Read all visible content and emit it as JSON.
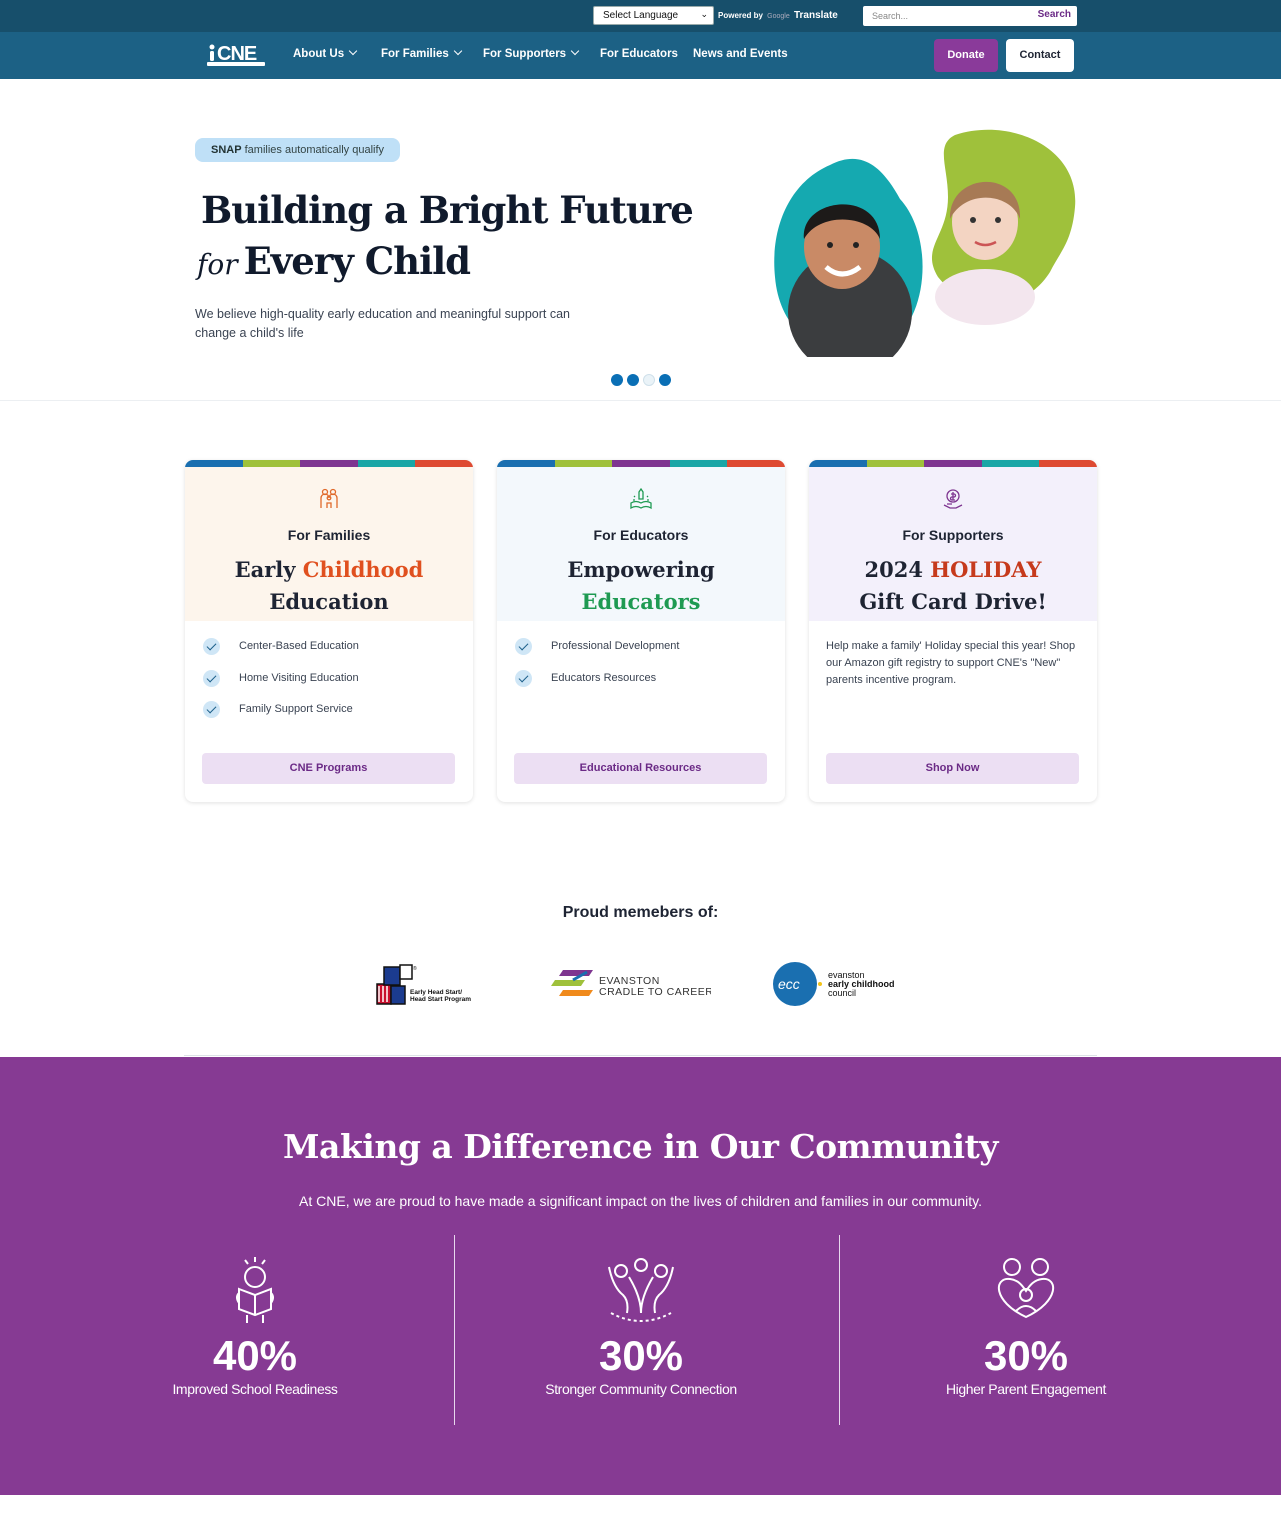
{
  "topbar": {
    "language_select": "Select Language",
    "powered_by": "Powered by",
    "google": "Google",
    "translate": "Translate",
    "search_placeholder": "Search...",
    "search_button": "Search"
  },
  "nav": {
    "logo_text": "CNE",
    "items": [
      {
        "label": "About Us",
        "has_dropdown": true
      },
      {
        "label": "For Families",
        "has_dropdown": true
      },
      {
        "label": "For Supporters",
        "has_dropdown": true
      },
      {
        "label": "For Educators",
        "has_dropdown": false
      },
      {
        "label": "News and Events",
        "has_dropdown": false
      }
    ],
    "donate": "Donate",
    "contact": "Contact"
  },
  "hero": {
    "badge_bold": "SNAP",
    "badge_rest": "families automatically qualify",
    "title_line1": "Building a Bright Future",
    "title_for": "for",
    "title_line2": "Every Child",
    "paragraph": "We believe high-quality early education and meaningful support can change a child's life",
    "slides_count": 4,
    "active_slide": 3
  },
  "cards": [
    {
      "kicker": "For Families",
      "title_a": "Early ",
      "title_accent": "Childhood",
      "title_b": "Education",
      "accent_color": "#e0501f",
      "icon": "family-icon",
      "items": [
        "Center-Based Education",
        "Home Visiting Education",
        "Family Support Service"
      ],
      "button": "CNE Programs"
    },
    {
      "kicker": "For Educators",
      "title_a": "Empowering",
      "title_accent": "Educators",
      "accent_color": "#1e9a52",
      "icon": "school-book-icon",
      "items": [
        "Professional Development",
        "Educators Resources"
      ],
      "button": "Educational Resources"
    },
    {
      "kicker": "For Supporters",
      "title_a": "2024 ",
      "title_accent": "HOLIDAY",
      "title_b": "Gift Card Drive!",
      "accent_color": "#c63a1c",
      "icon": "donation-hand-icon",
      "paragraph": "Help make a family' Holiday special this year! Shop our Amazon gift registry to support CNE's \"New\" parents incentive program.",
      "button": "Shop Now"
    }
  ],
  "members": {
    "title": "Proud memebers of:",
    "logos": [
      {
        "name": "Early Head Start/ Head Start Program",
        "line1": "Early Head Start/",
        "line2": "Head Start Program",
        "mark": "®"
      },
      {
        "name": "Evanston Cradle to Career",
        "line1": "EVANSTON",
        "line2": "CRADLE TO CAREER"
      },
      {
        "name": "evanston early childhood council",
        "line1": "evanston",
        "line2": "early childhood",
        "line3": "council",
        "mark": "ecc"
      }
    ]
  },
  "impact": {
    "title": "Making a Difference in Our Community",
    "subtitle": "At CNE, we are proud to have made a significant impact on the lives of children and families in our community.",
    "stats": [
      {
        "value": "40%",
        "label": "Improved School Readiness",
        "icon": "child-reading-icon"
      },
      {
        "value": "30%",
        "label": "Stronger Community Connection",
        "icon": "community-people-icon"
      },
      {
        "value": "30%",
        "label": "Higher Parent Engagement",
        "icon": "parent-child-icon"
      }
    ]
  },
  "colors": {
    "topbar": "#174f6b",
    "nav": "#1c6185",
    "donate": "#8a3a9a",
    "impact_bg": "#863a93",
    "stripe_colors": [
      "#1a6fb0",
      "#9fc13b",
      "#7e3590",
      "#1aa6a6",
      "#de4a32"
    ],
    "card_head_bg": [
      "#fdf5ec",
      "#f3f8fc",
      "#f3f0fb"
    ]
  }
}
